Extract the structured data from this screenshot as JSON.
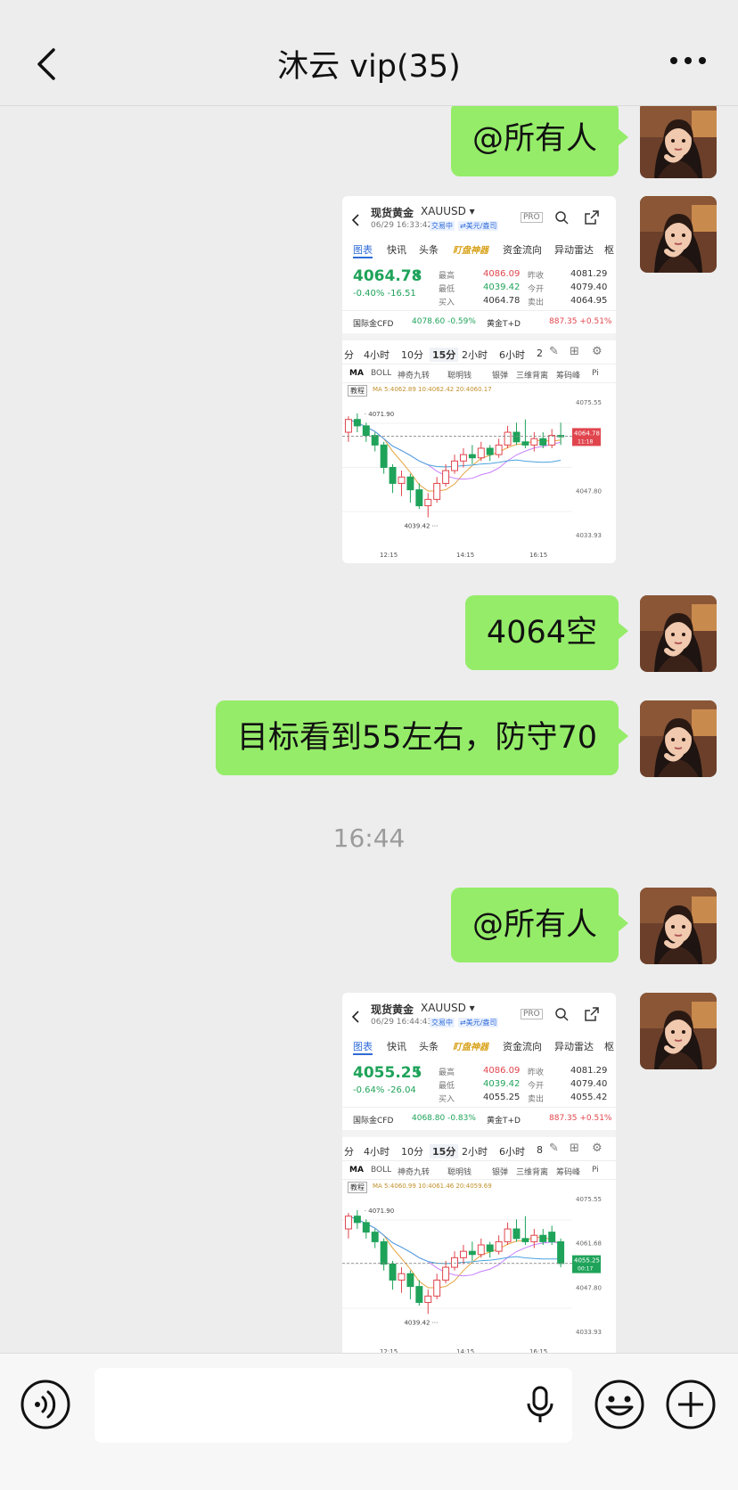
{
  "header": {
    "title": "沐云 vip(35)"
  },
  "messages": {
    "m1": "@所有人",
    "m3": "4064空",
    "m4": "目标看到55左右，防守70",
    "time": "16:44",
    "m5": "@所有人"
  },
  "shot1": {
    "name": "现货黄金",
    "code": "XAUUSD ▾",
    "date": "06/29 16:33:42",
    "status": "交易中",
    "unit": "⇄美元/盎司",
    "tabs": [
      "图表",
      "快讯",
      "头条",
      "盯盘神器",
      "资金流向",
      "异动雷达",
      "枢"
    ],
    "price": "4064.78",
    "arrow": "⬇",
    "chg": "-0.40%  -16.51",
    "k1": "最高",
    "v1": "4086.09",
    "k2": "最低",
    "v2": "4039.42",
    "k3": "买入",
    "v3": "4064.78",
    "k4": "昨收",
    "v4": "4081.29",
    "k5": "今开",
    "v5": "4079.40",
    "k6": "卖出",
    "v6": "4064.95",
    "cfd": "国际金CFD",
    "cfd_v": "4078.60  -0.59%",
    "td": "黄金T+D",
    "td_v": "887.35  +0.51%",
    "periods": [
      "分",
      "4小时",
      "10分",
      "15分",
      "2小时",
      "6小时",
      "2"
    ],
    "inds": [
      "MA",
      "BOLL",
      "神奇九转",
      "聪明钱",
      "银弹",
      "三维背离",
      "筹码峰",
      "Pi"
    ],
    "ma": "MA 5:4062.89  10:4062.42  20:4060.17",
    "tag": "教程",
    "y": [
      "4075.55",
      "4047.80",
      "4033.93"
    ],
    "hi": "4071.90",
    "lo": "4039.42",
    "cur": "4064.78",
    "cur_t": "11:18",
    "x": [
      "12:15",
      "14:15",
      "16:15"
    ]
  },
  "shot2": {
    "name": "现货黄金",
    "code": "XAUUSD ▾",
    "date": "06/29 16:44:43",
    "status": "交易中",
    "unit": "⇄美元/盎司",
    "tabs": [
      "图表",
      "快讯",
      "头条",
      "盯盘神器",
      "资金流向",
      "异动雷达",
      "枢"
    ],
    "price": "4055.25",
    "arrow": "⬇",
    "chg": "-0.64%  -26.04",
    "k1": "最高",
    "v1": "4086.09",
    "k2": "最低",
    "v2": "4039.42",
    "k3": "买入",
    "v3": "4055.25",
    "k4": "昨收",
    "v4": "4081.29",
    "k5": "今开",
    "v5": "4079.40",
    "k6": "卖出",
    "v6": "4055.42",
    "cfd": "国际金CFD",
    "cfd_v": "4068.80  -0.83%",
    "td": "黄金T+D",
    "td_v": "887.35  +0.51%",
    "periods": [
      "分",
      "4小时",
      "10分",
      "15分",
      "2小时",
      "6小时",
      "8"
    ],
    "inds": [
      "MA",
      "BOLL",
      "神奇九转",
      "聪明钱",
      "银弹",
      "三维背离",
      "筹码峰",
      "Pi"
    ],
    "ma": "MA 5:4060.99  10:4061.46  20:4059.69",
    "tag": "教程",
    "y": [
      "4075.55",
      "4061.68",
      "4047.80",
      "4033.93"
    ],
    "hi": "4071.90",
    "lo": "4039.42",
    "cur": "4055.25",
    "cur_t": "00:17",
    "x": [
      "12:15",
      "14:15",
      "16:15"
    ]
  },
  "colors": {
    "bubble": "#95ec69",
    "up": "#e0454d",
    "down": "#1fa35a"
  }
}
